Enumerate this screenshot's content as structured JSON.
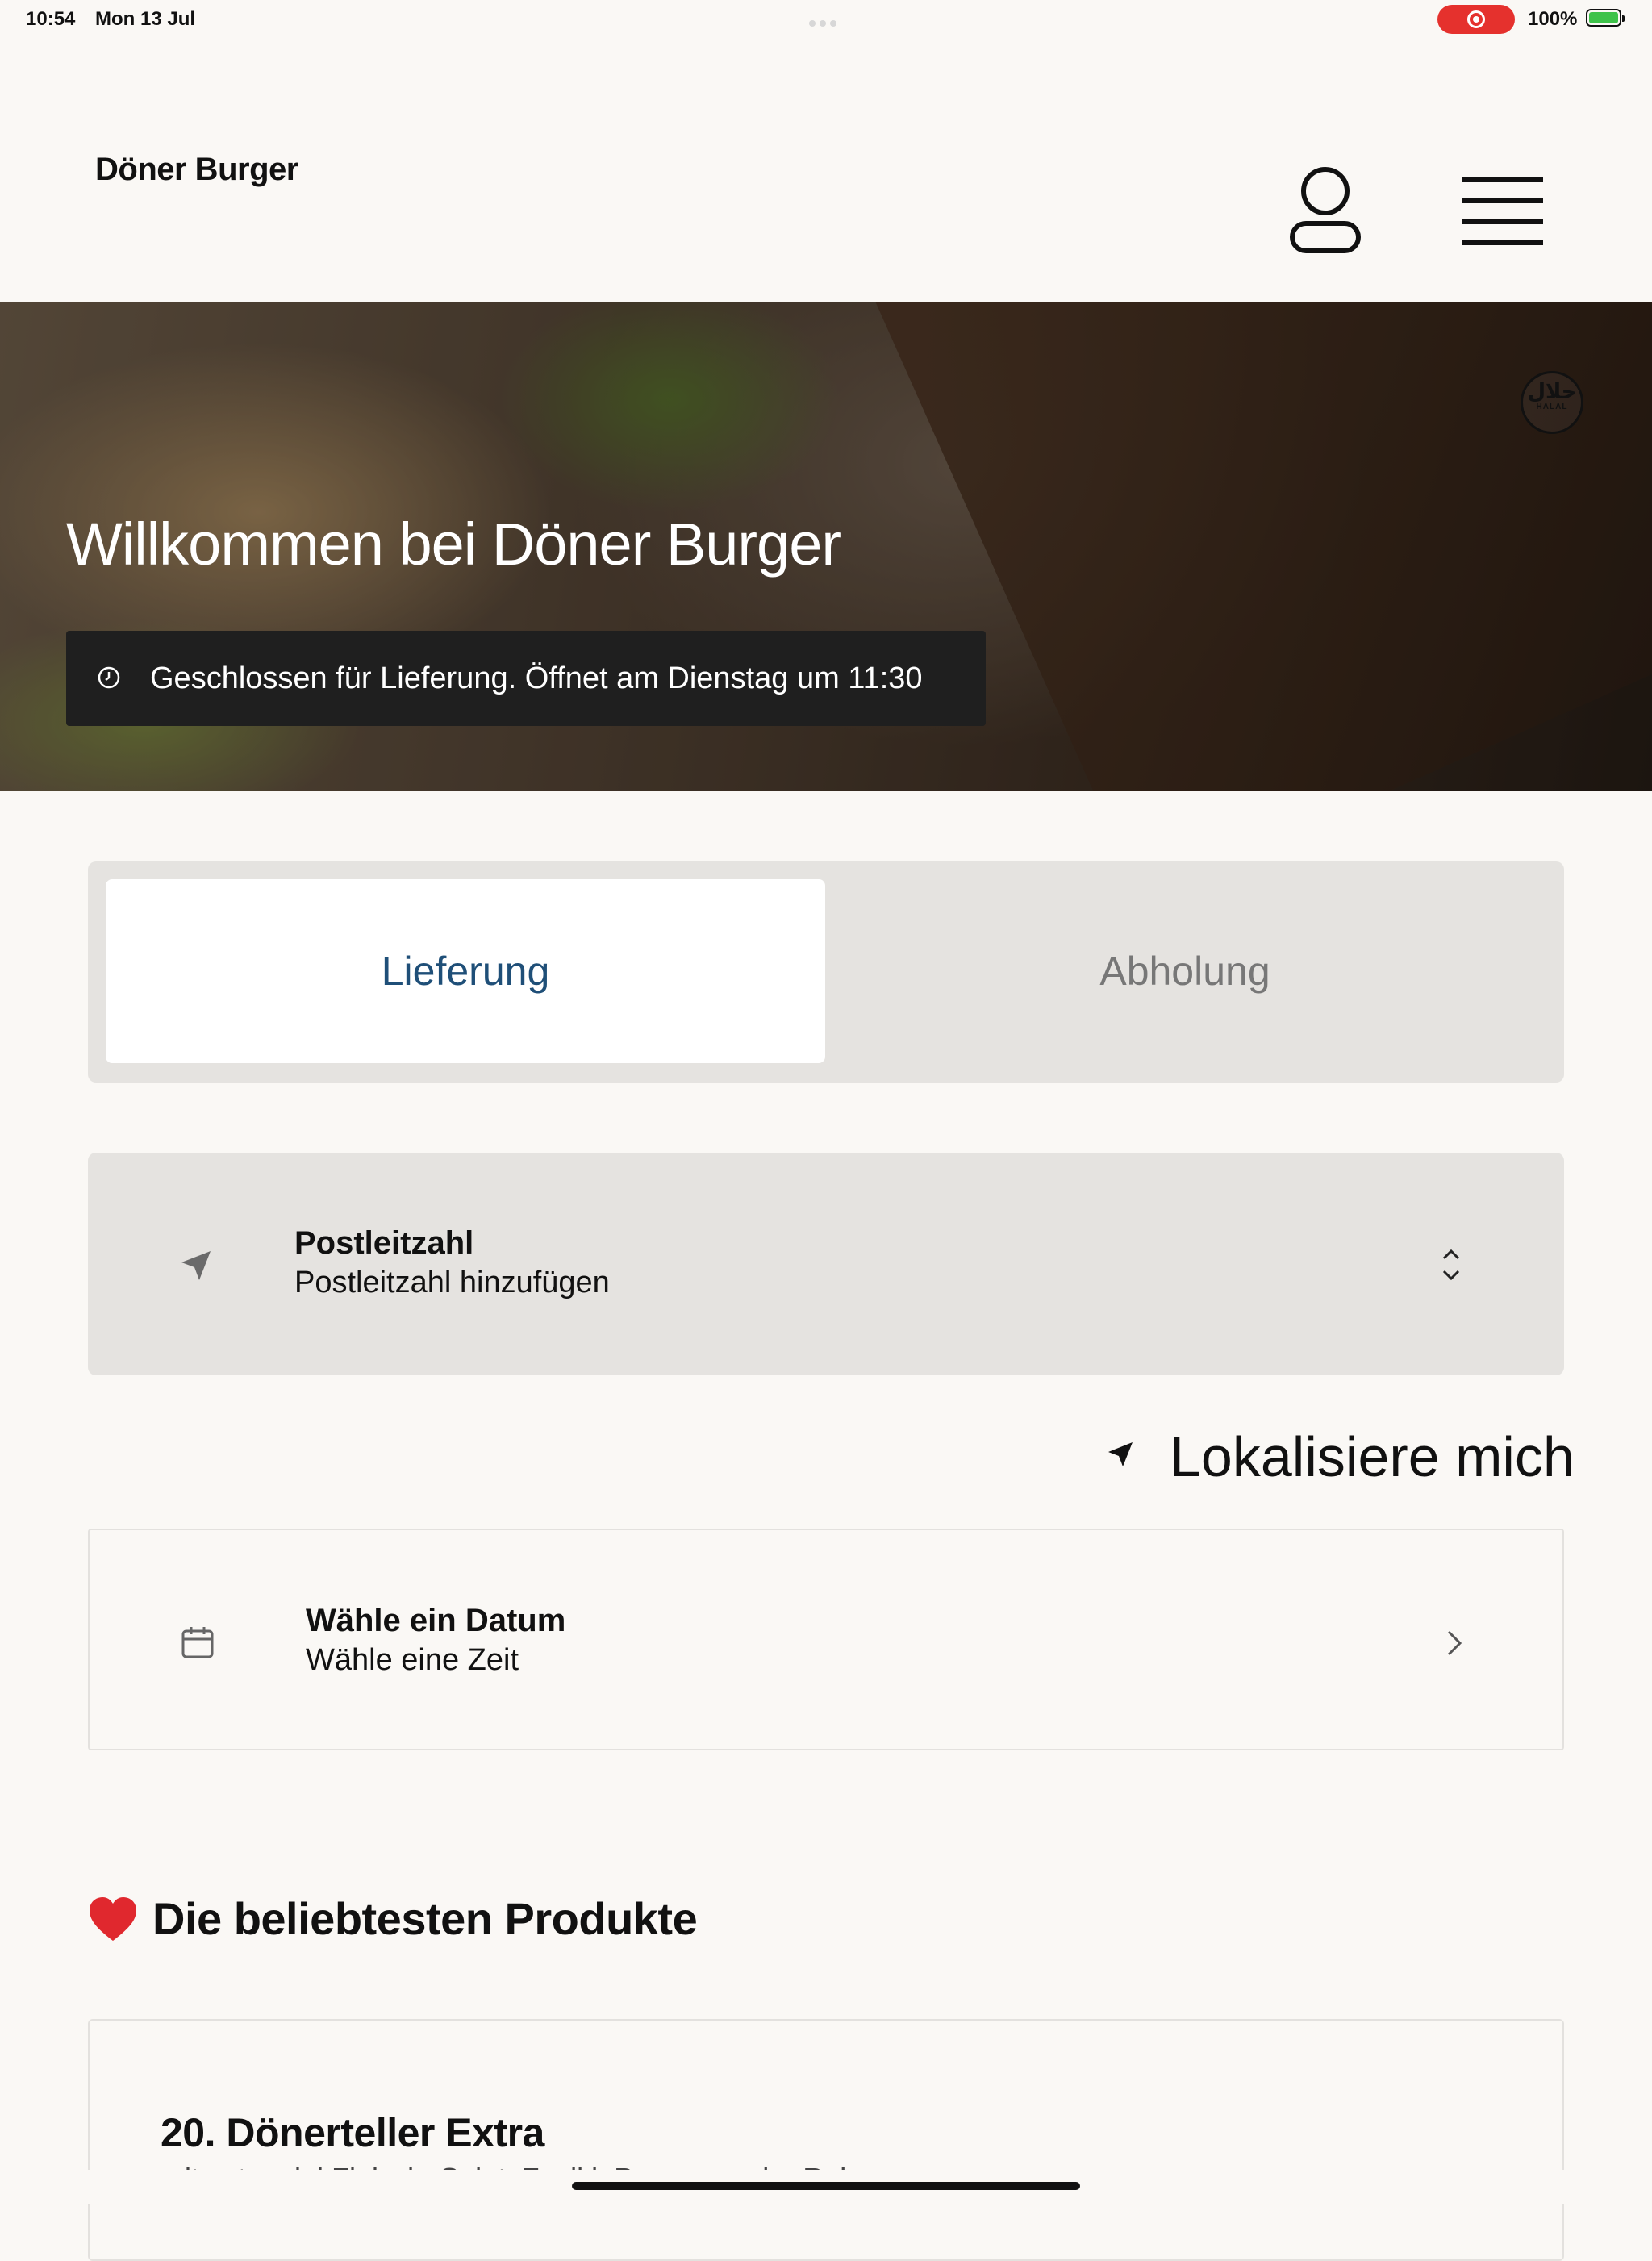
{
  "status_bar": {
    "time": "10:54",
    "date": "Mon 13 Jul",
    "battery": "100%"
  },
  "header": {
    "brand": "Döner Burger",
    "account_icon": "user-icon",
    "menu_icon": "hamburger-menu-icon"
  },
  "hero": {
    "title": "Willkommen bei Döner Burger",
    "badge_arabic": "حلال",
    "badge_text": "HALAL",
    "status_text": "Geschlossen für Lieferung. Öffnet am Dienstag um 11:30"
  },
  "order_mode": {
    "tabs": [
      {
        "label": "Lieferung",
        "active": true
      },
      {
        "label": "Abholung",
        "active": false
      }
    ],
    "active_color": "#1f4f78"
  },
  "postcode": {
    "label": "Postleitzahl",
    "placeholder": "Postleitzahl hinzufügen"
  },
  "locate": {
    "label": "Lokalisiere mich"
  },
  "schedule": {
    "title": "Wähle ein Datum",
    "subtitle": "Wähle eine Zeit"
  },
  "popular": {
    "title": "Die beliebtesten Produkte",
    "products": [
      {
        "name": "20. Dönerteller Extra",
        "description": "mit extra viel Fleisch, Salat, Zaziki, Pommes oder Reis"
      }
    ]
  }
}
